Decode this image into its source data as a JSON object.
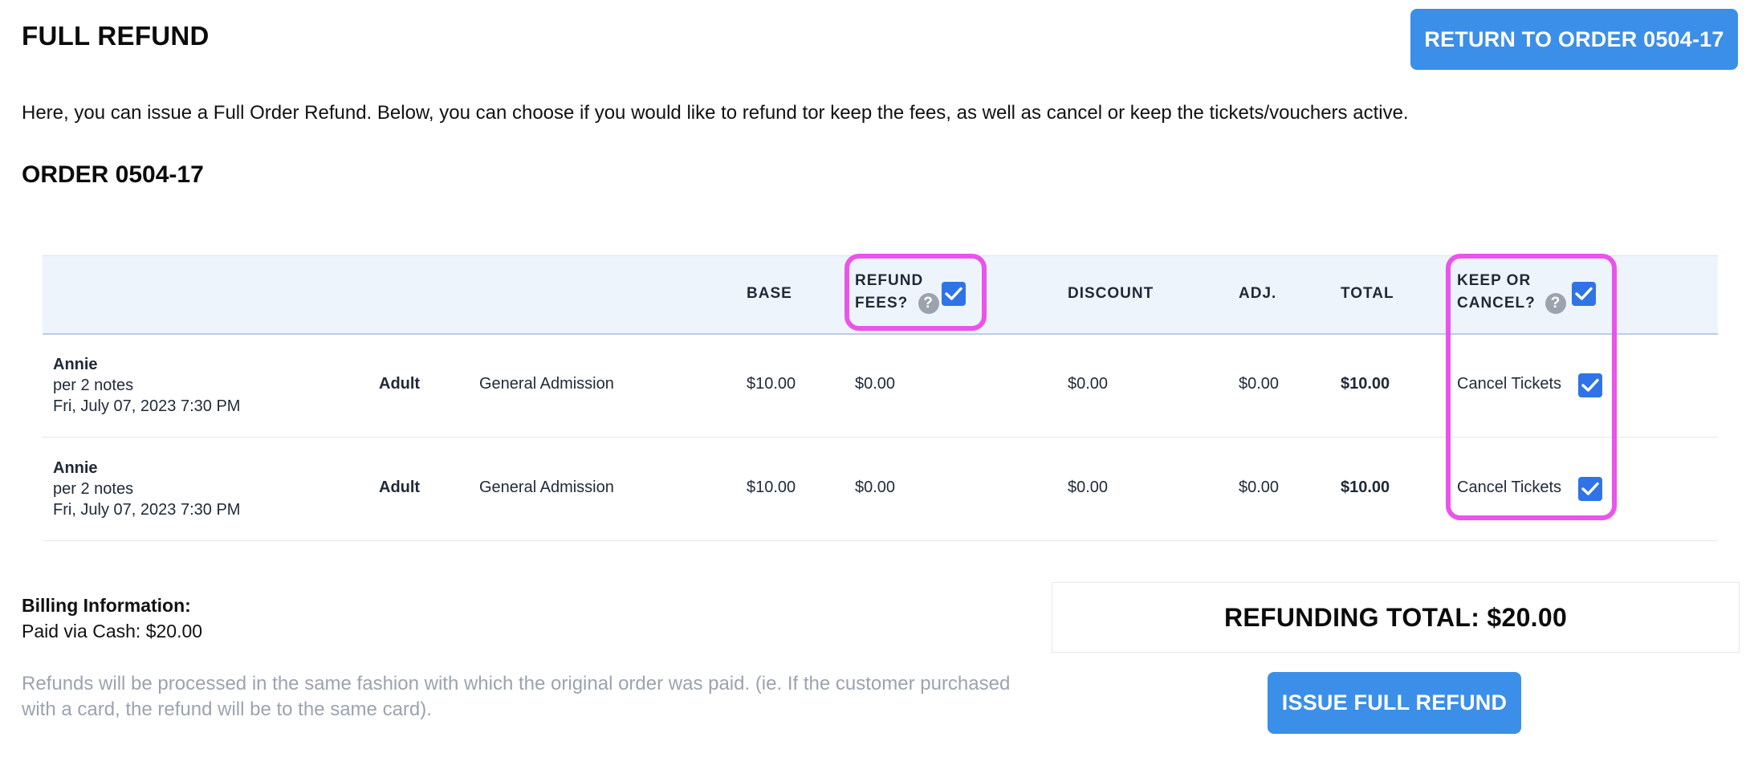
{
  "page": {
    "title": "FULL REFUND",
    "return_button": "RETURN TO ORDER 0504-17",
    "intro": "Here, you can issue a Full Order Refund. Below, you can choose if you would like to refund tor keep the fees, as well as cancel or keep the tickets/vouchers active.",
    "order_title": "ORDER 0504-17"
  },
  "table": {
    "headers": {
      "base": "BASE",
      "refund_fees_line1": "REFUND",
      "refund_fees_line2": "FEES?",
      "discount": "DISCOUNT",
      "adj": "ADJ.",
      "total": "TOTAL",
      "keep_cancel_line1": "KEEP OR",
      "keep_cancel_line2": "CANCEL?"
    },
    "help_glyph": "?",
    "refund_fees_checked": true,
    "keep_cancel_checked": true,
    "rows": [
      {
        "name": "Annie",
        "notes": "per 2 notes",
        "datetime": "Fri, July 07, 2023 7:30 PM",
        "ticket_type": "Adult",
        "section": "General Admission",
        "base": "$10.00",
        "fees": "$0.00",
        "discount": "$0.00",
        "adj": "$0.00",
        "total": "$10.00",
        "action": "Cancel Tickets",
        "action_checked": true
      },
      {
        "name": "Annie",
        "notes": "per 2 notes",
        "datetime": "Fri, July 07, 2023 7:30 PM",
        "ticket_type": "Adult",
        "section": "General Admission",
        "base": "$10.00",
        "fees": "$0.00",
        "discount": "$0.00",
        "adj": "$0.00",
        "total": "$10.00",
        "action": "Cancel Tickets",
        "action_checked": true
      }
    ]
  },
  "billing": {
    "heading": "Billing Information:",
    "paid": "Paid via Cash: $20.00"
  },
  "note": "Refunds will be processed in the same fashion with which the original order was paid. (ie. If the customer purchased with a card, the refund will be to the same card).",
  "summary": {
    "refunding_total": "REFUNDING TOTAL: $20.00",
    "issue_button": "ISSUE FULL REFUND"
  },
  "colors": {
    "accent": "#3b8fe8",
    "checkbox": "#2f74e6",
    "highlight": "#e954ec",
    "header_bg": "#eef4fb"
  }
}
